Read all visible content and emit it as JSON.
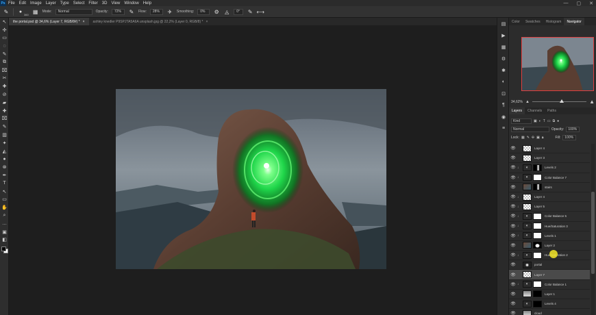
{
  "menubar": {
    "logo": "Ps",
    "items": [
      "File",
      "Edit",
      "Image",
      "Layer",
      "Type",
      "Select",
      "Filter",
      "3D",
      "View",
      "Window",
      "Help"
    ],
    "win_controls": [
      "—",
      "▢",
      "✕"
    ]
  },
  "options": {
    "brush_size": "360",
    "mode_label": "Mode:",
    "mode_value": "Normal",
    "opacity_label": "Opacity:",
    "opacity_value": "72%",
    "flow_label": "Flow:",
    "flow_value": "28%",
    "smoothing_label": "Smoothing:",
    "smoothing_value": "0%",
    "angle_value": "0°"
  },
  "tabs": [
    {
      "label": "the portal.psd @ 34,6% (Layer 7, RGB/8#) *",
      "close": "×"
    },
    {
      "label": "ashley knedler P9SPJTA5A6A unsplash.jpg @ 22,2% (Layer 0, RGB/8) *",
      "close": "×"
    }
  ],
  "tools": [
    "↖",
    "✣",
    "▭",
    "◌",
    "✎",
    "⧉",
    "⌧",
    "✂",
    "✚",
    "⊘",
    "▰",
    "✚",
    "⌧",
    "✎",
    "▥",
    "✦",
    "◭",
    "●",
    "⊗",
    "✒",
    "T",
    "↖",
    "▭",
    "✋",
    "⌕",
    "…",
    "▣",
    "◧"
  ],
  "midstrip_icons": [
    "▤",
    "▶",
    "▦",
    "⚙",
    "✱",
    "◐",
    "⊡",
    "¶",
    "◉",
    "≡"
  ],
  "navigator": {
    "tabs": [
      "Color",
      "Swatches",
      "Histogram",
      "Navigator"
    ],
    "active_tab": 3,
    "zoom": "34,62%",
    "zoom_level": 0.55
  },
  "layers_panel": {
    "tabs": [
      "Layers",
      "Channels",
      "Paths"
    ],
    "active_tab": 0,
    "filter_value": "Kind",
    "blend_mode": "Normal",
    "opacity_label": "Opacity:",
    "opacity_value": "100%",
    "lock_label": "Lock:",
    "fill_label": "Fill:",
    "fill_value": "100%",
    "layers": [
      {
        "name": "Layer 4",
        "thumb": "checker",
        "mask": "",
        "clip": false
      },
      {
        "name": "Layer 3",
        "thumb": "checker",
        "mask": "",
        "clip": false
      },
      {
        "name": "Levels 2",
        "thumb": "adj",
        "mask": "blackmask",
        "clip": true
      },
      {
        "name": "Color Balance 7",
        "thumb": "adj",
        "mask": "white",
        "clip": true
      },
      {
        "name": "stairs",
        "thumb": "photo",
        "mask": "blackmask",
        "clip": false
      },
      {
        "name": "Layer 4",
        "thumb": "checker",
        "mask": "",
        "clip": true
      },
      {
        "name": "Layer 5",
        "thumb": "checker",
        "mask": "",
        "clip": true
      },
      {
        "name": "Color Balance 5",
        "thumb": "adj",
        "mask": "white",
        "clip": true
      },
      {
        "name": "Hue/Saturation 3",
        "thumb": "adj",
        "mask": "white",
        "clip": true
      },
      {
        "name": "Levels 1",
        "thumb": "adj",
        "mask": "white",
        "clip": true
      },
      {
        "name": "Layer 2",
        "thumb": "photo",
        "mask": "blackshape",
        "clip": false
      },
      {
        "name": "Hue/Saturation 2",
        "thumb": "adj",
        "mask": "white",
        "clip": true
      },
      {
        "name": "portal",
        "thumb": "dark",
        "mask": "",
        "clip": false
      },
      {
        "name": "Layer 7",
        "thumb": "checker",
        "mask": "",
        "clip": false,
        "selected": true
      },
      {
        "name": "Color Balance 1",
        "thumb": "adj",
        "mask": "white",
        "clip": true
      },
      {
        "name": "Layer 1",
        "thumb": "sky",
        "mask": "black",
        "clip": false
      },
      {
        "name": "Levels 4",
        "thumb": "adj",
        "mask": "black",
        "clip": false
      },
      {
        "name": "cloud",
        "thumb": "sky",
        "mask": "",
        "clip": false
      }
    ]
  },
  "colors": {
    "accent_red": "#e04040",
    "portal_green": "#3cff6a",
    "cursor_yellow": "#f5e628"
  }
}
